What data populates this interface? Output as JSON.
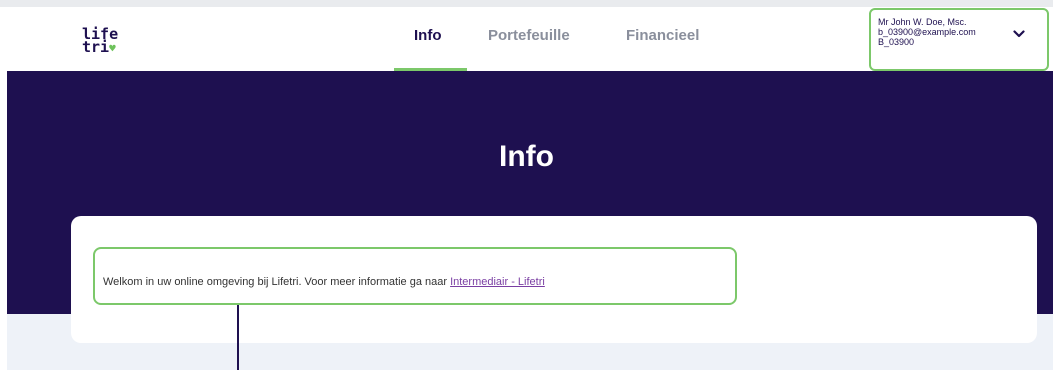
{
  "header": {
    "logo": {
      "line1": "life",
      "line2": "tri",
      "heart": "♥"
    },
    "nav": [
      {
        "label": "Info",
        "active": true
      },
      {
        "label": "Portefeuille",
        "active": false
      },
      {
        "label": "Financieel",
        "active": false
      }
    ],
    "user": {
      "name": "Mr John W. Doe, Msc.",
      "email": "b_03900@example.com",
      "id": "B_03900"
    }
  },
  "banner": {
    "title": "Info"
  },
  "content": {
    "welcome_text": "Welkom in uw online omgeving bij Lifetri. Voor meer informatie ga naar ",
    "link_label": "Intermediair - Lifetri"
  },
  "colors": {
    "brand_navy": "#1e1050",
    "accent_green": "#7cc86a",
    "link_purple": "#7a3ea3"
  }
}
